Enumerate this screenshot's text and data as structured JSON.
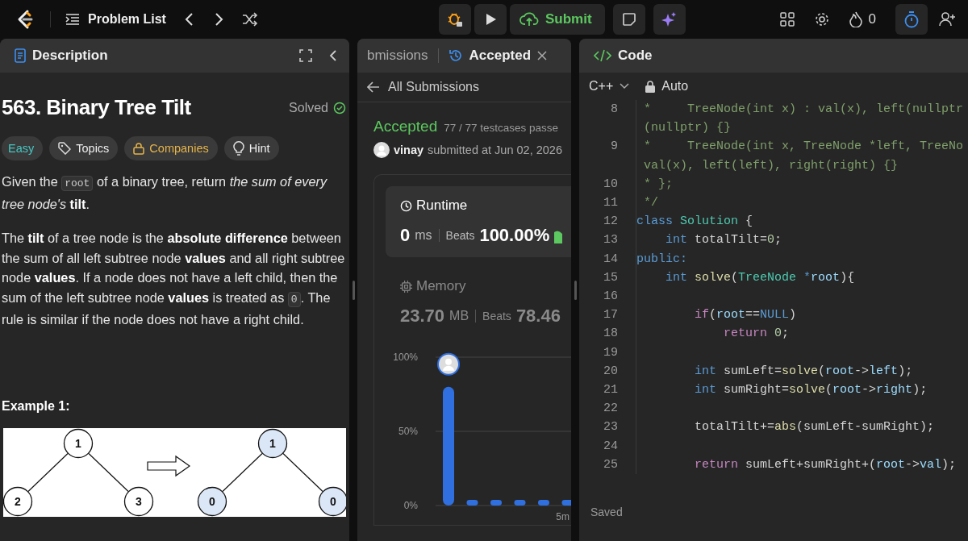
{
  "topbar": {
    "title": "Problem List",
    "streak": "0",
    "submit": "Submit"
  },
  "description": {
    "tab": "Description",
    "title": "563. Binary Tree Tilt",
    "status": "Solved",
    "tags": [
      {
        "kind": "difficulty",
        "label": "Easy"
      },
      {
        "kind": "topics",
        "label": "Topics"
      },
      {
        "kind": "companies",
        "label": "Companies"
      },
      {
        "kind": "hint",
        "label": "Hint"
      }
    ],
    "paragraphs": [
      [
        {
          "kind": "text",
          "text": "Given the "
        },
        {
          "kind": "code",
          "text": "root"
        },
        {
          "kind": "text",
          "text": " of a binary tree, return *the sum of every tree node's* **tilt**."
        }
      ],
      [
        {
          "kind": "text",
          "text": "The **tilt** of a tree node is the **absolute difference** between the sum of all left subtree node **values** and all right subtree node **values**. If a node does not have a left child, then the sum of the left subtree node **values** is treated as "
        },
        {
          "kind": "code",
          "text": "0"
        },
        {
          "kind": "text",
          "text": ". The rule is similar if the node does not have a right child."
        }
      ]
    ],
    "example_title": "Example 1:",
    "example_diagram": {
      "before": {
        "value": "1",
        "highlighted": false,
        "children": [
          {
            "value": "2",
            "highlighted": false
          },
          {
            "value": "3",
            "highlighted": false
          }
        ]
      },
      "after": {
        "value": "1",
        "highlighted": true,
        "children": [
          {
            "value": "0",
            "highlighted": true
          },
          {
            "value": "0",
            "highlighted": true
          }
        ]
      }
    }
  },
  "submission": {
    "tabs": [
      {
        "label": "bmissions",
        "selected": false
      },
      {
        "label": "Accepted",
        "selected": true
      }
    ],
    "back": "All Submissions",
    "status": "Accepted",
    "testcases": "77 / 77 testcases passe",
    "user": "vinay",
    "submitted": "submitted at Jun 02, 2026",
    "metrics": [
      {
        "kind": "runtime",
        "label": "Runtime",
        "value": "0",
        "unit": "ms",
        "beats_label": "Beats",
        "beats": "100.00%",
        "selected": true
      },
      {
        "kind": "memory",
        "label": "Memory",
        "value": "23.70",
        "unit": "MB",
        "beats_label": "Beats",
        "beats": "78.46",
        "selected": false
      }
    ],
    "chart_data": {
      "type": "bar",
      "values": [
        80,
        3.8,
        3.8,
        3.8,
        3.8,
        3.8
      ],
      "ylim": [
        0,
        100
      ],
      "yticks": [
        {
          "value": 0,
          "label": "0%"
        },
        {
          "value": 50,
          "label": "50%"
        },
        {
          "value": 100,
          "label": "100%"
        }
      ],
      "annotations": [
        "5m"
      ]
    }
  },
  "code": {
    "tab": "Code",
    "language": "C++",
    "mode": "Auto",
    "status": "Saved",
    "lines": [
      {
        "n": "8",
        "rows": [
          [
            {
              "text": " *     TreeNode(int x) : val(x), left(nullptr",
              "kind": "comment"
            }
          ],
          [
            {
              "text": "(nullptr) {}",
              "kind": "comment"
            }
          ]
        ]
      },
      {
        "n": "9",
        "rows": [
          [
            {
              "text": " *     TreeNode(int x, TreeNode *left, TreeNo",
              "kind": "comment"
            }
          ],
          [
            {
              "text": "val(x), left(left), right(right) {}",
              "kind": "comment"
            }
          ]
        ]
      },
      {
        "n": "10",
        "rows": [
          [
            {
              "text": " * };",
              "kind": "comment"
            }
          ]
        ]
      },
      {
        "n": "11",
        "rows": [
          [
            {
              "text": " */",
              "kind": "comment"
            }
          ]
        ]
      },
      {
        "n": "12",
        "rows": [
          [
            {
              "text": "class",
              "kind": "keyword"
            },
            {
              "text": " ",
              "kind": "plain"
            },
            {
              "text": "Solution",
              "kind": "type"
            },
            {
              "text": " {",
              "kind": "plain"
            }
          ]
        ]
      },
      {
        "n": "13",
        "rows": [
          [
            {
              "text": "    ",
              "kind": "plain"
            },
            {
              "text": "int",
              "kind": "keyword"
            },
            {
              "text": " totalTilt=",
              "kind": "plain"
            },
            {
              "text": "0",
              "kind": "number"
            },
            {
              "text": ";",
              "kind": "plain"
            }
          ]
        ]
      },
      {
        "n": "14",
        "rows": [
          [
            {
              "text": "public:",
              "kind": "keyword"
            }
          ]
        ]
      },
      {
        "n": "15",
        "rows": [
          [
            {
              "text": "    ",
              "kind": "plain"
            },
            {
              "text": "int",
              "kind": "keyword"
            },
            {
              "text": " ",
              "kind": "plain"
            },
            {
              "text": "solve",
              "kind": "func"
            },
            {
              "text": "(",
              "kind": "plain"
            },
            {
              "text": "TreeNode",
              "kind": "type"
            },
            {
              "text": " *",
              "kind": "keyword"
            },
            {
              "text": "root",
              "kind": "var"
            },
            {
              "text": "){",
              "kind": "plain"
            }
          ]
        ]
      },
      {
        "n": "16"
      },
      {
        "n": "17",
        "rows": [
          [
            {
              "text": "        ",
              "kind": "plain"
            },
            {
              "text": "if",
              "kind": "control"
            },
            {
              "text": "(",
              "kind": "plain"
            },
            {
              "text": "root",
              "kind": "var"
            },
            {
              "text": "==",
              "kind": "plain"
            },
            {
              "text": "NULL",
              "kind": "keyword"
            },
            {
              "text": ")",
              "kind": "plain"
            }
          ]
        ]
      },
      {
        "n": "18",
        "rows": [
          [
            {
              "text": "            ",
              "kind": "plain"
            },
            {
              "text": "return",
              "kind": "control"
            },
            {
              "text": " ",
              "kind": "plain"
            },
            {
              "text": "0",
              "kind": "number"
            },
            {
              "text": ";",
              "kind": "plain"
            }
          ]
        ]
      },
      {
        "n": "19"
      },
      {
        "n": "20",
        "rows": [
          [
            {
              "text": "        ",
              "kind": "plain"
            },
            {
              "text": "int",
              "kind": "keyword"
            },
            {
              "text": " sumLeft=",
              "kind": "plain"
            },
            {
              "text": "solve",
              "kind": "func"
            },
            {
              "text": "(",
              "kind": "plain"
            },
            {
              "text": "root",
              "kind": "var"
            },
            {
              "text": "->",
              "kind": "plain"
            },
            {
              "text": "left",
              "kind": "var"
            },
            {
              "text": ");",
              "kind": "plain"
            }
          ]
        ]
      },
      {
        "n": "21",
        "rows": [
          [
            {
              "text": "        ",
              "kind": "plain"
            },
            {
              "text": "int",
              "kind": "keyword"
            },
            {
              "text": " sumRight=",
              "kind": "plain"
            },
            {
              "text": "solve",
              "kind": "func"
            },
            {
              "text": "(",
              "kind": "plain"
            },
            {
              "text": "root",
              "kind": "var"
            },
            {
              "text": "->",
              "kind": "plain"
            },
            {
              "text": "right",
              "kind": "var"
            },
            {
              "text": ");",
              "kind": "plain"
            }
          ]
        ]
      },
      {
        "n": "22"
      },
      {
        "n": "23",
        "rows": [
          [
            {
              "text": "        totalTilt+=",
              "kind": "plain"
            },
            {
              "text": "abs",
              "kind": "func"
            },
            {
              "text": "(sumLeft-sumRight);",
              "kind": "plain"
            }
          ]
        ]
      },
      {
        "n": "24"
      },
      {
        "n": "25",
        "rows": [
          [
            {
              "text": "        ",
              "kind": "plain"
            },
            {
              "text": "return",
              "kind": "control"
            },
            {
              "text": " sumLeft+sumRight+(",
              "kind": "plain"
            },
            {
              "text": "root",
              "kind": "var"
            },
            {
              "text": "->",
              "kind": "plain"
            },
            {
              "text": "val",
              "kind": "var"
            },
            {
              "text": ");",
              "kind": "plain"
            }
          ]
        ]
      }
    ]
  }
}
